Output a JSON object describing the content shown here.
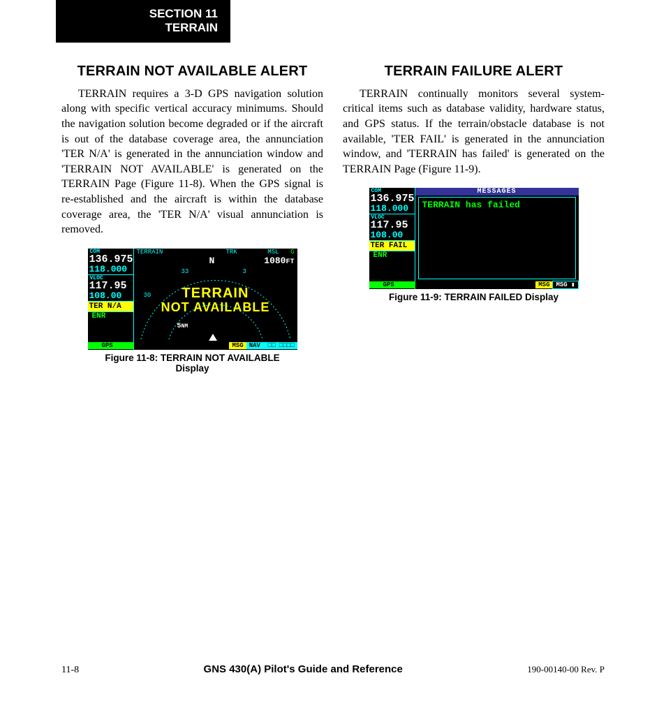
{
  "tab": {
    "line1": "SECTION 11",
    "line2": "TERRAIN"
  },
  "col1": {
    "heading": "TERRAIN NOT AVAILABLE ALERT",
    "para": "TERRAIN requires a 3-D GPS navigation solution along with specific vertical accuracy minimums.  Should the navigation solution become degraded or if the aircraft is out of the database coverage area, the annunciation 'TER N/A' is generated in the annunciation window and 'TERRAIN NOT AVAILABLE' is generated on the TERRAIN Page (Figure 11-8).  When the GPS signal is re-established and the aircraft is within the database coverage area, the 'TER N/A' visual annunciation is removed.",
    "caption": "Figure 11-8: TERRAIN NOT AVAILABLE Display"
  },
  "col2": {
    "heading": "TERRAIN FAILURE ALERT",
    "para": "TERRAIN continually monitors several system-critical items such as database validity, hardware status, and GPS status.  If the terrain/obstacle database is not available, 'TER FAIL' is generated in the annunciation window, and 'TERRAIN has failed' is generated on the TERRAIN Page (Figure 11-9).",
    "caption": "Figure 11-9: TERRAIN FAILED Display"
  },
  "screen1": {
    "com_label": "COM",
    "com_main": "136.975",
    "com_sub": "118.000",
    "vloc_label": "VLOC",
    "vloc_main": "117.95",
    "vloc_sub": "108.00",
    "annun": "TER N/A",
    "enr": "ENR",
    "top_terrain": "TERRAIN",
    "top_trk": "TRK",
    "top_n": "N",
    "top_msl": "MSL",
    "top_alt": "1080",
    "top_g": "G",
    "tick33": "33",
    "tick30": "30",
    "tick3": "3",
    "scale": "5",
    "scale_unit": "NM",
    "overlay1": "TERRAIN",
    "overlay2": "NOT AVAILABLE",
    "gps": "GPS",
    "msg": "MSG",
    "nav": "NAV"
  },
  "screen2": {
    "com_label": "COM",
    "com_main": "136.975",
    "com_sub": "118.000",
    "vloc_label": "VLOC",
    "vloc_main": "117.95",
    "vloc_sub": "108.00",
    "annun": "TER FAIL",
    "enr": "ENR",
    "header": "MESSAGES",
    "msg_text": "TERRAIN has failed",
    "gps": "GPS",
    "msg": "MSG",
    "msg2": "MSG"
  },
  "footer": {
    "page": "11-8",
    "title": "GNS 430(A) Pilot's Guide and Reference",
    "rev": "190-00140-00  Rev. P"
  }
}
